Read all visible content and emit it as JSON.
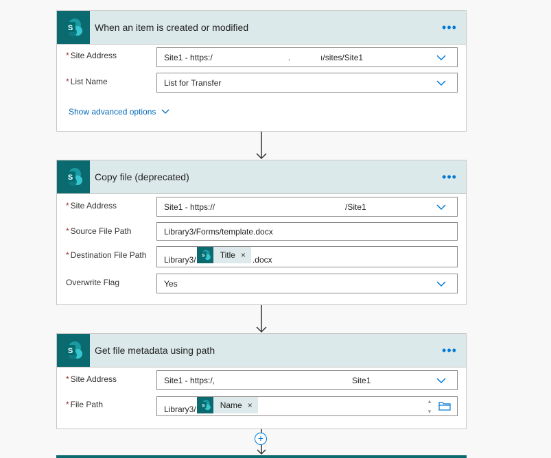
{
  "colors": {
    "sharepoint_teal": "#0b6a6f",
    "header_bg": "#dce9eb",
    "link_blue": "#0067b8",
    "required_red": "#a4262c"
  },
  "card1": {
    "title": "When an item is created or modified",
    "more_label": "•••",
    "site_label": "Site Address",
    "site_value_prefix": "Site1 - https:/",
    "site_value_mid": ".",
    "site_value_suffix": "ı/sites/Site1",
    "list_label": "List Name",
    "list_value": "List for Transfer",
    "advanced_label": "Show advanced options"
  },
  "card2": {
    "title": "Copy file (deprecated)",
    "more_label": "•••",
    "site_label": "Site Address",
    "site_value_prefix": "Site1 - https://",
    "site_value_suffix": "/Site1",
    "source_label": "Source File Path",
    "source_value": "Library3/Forms/template.docx",
    "dest_label": "Destination File Path",
    "dest_prefix": "Library3/",
    "dest_token": "Title",
    "dest_suffix": ".docx",
    "overwrite_label": "Overwrite Flag",
    "overwrite_value": "Yes"
  },
  "card3": {
    "title": "Get file metadata using path",
    "more_label": "•••",
    "site_label": "Site Address",
    "site_value_prefix": "Site1 - https:/,",
    "site_value_suffix": "Site1",
    "path_label": "File Path",
    "path_prefix": "Library3/",
    "path_token": "Name"
  },
  "required_mark": "*",
  "token_close": "×",
  "add_step_label": "+",
  "icons": [
    "sharepoint-icon",
    "chevron-down-icon",
    "folder-icon",
    "down-arrow-icon",
    "plus-icon"
  ]
}
